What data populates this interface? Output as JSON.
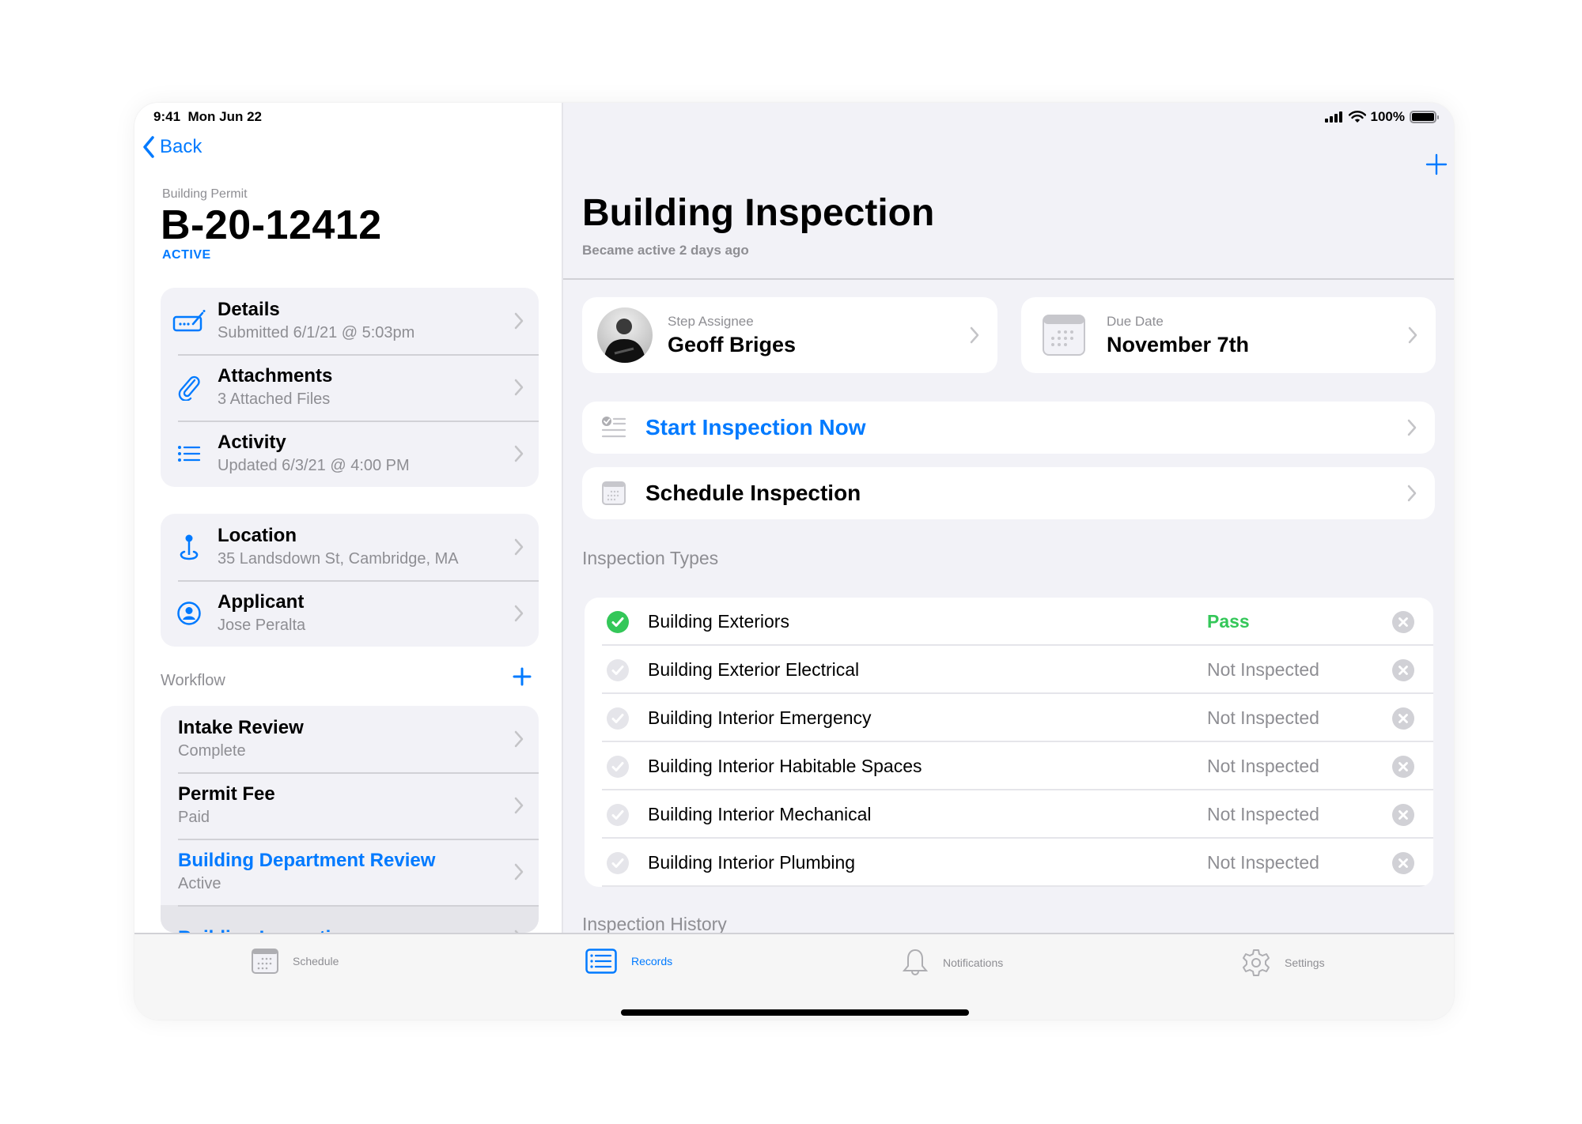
{
  "status_bar": {
    "time": "9:41",
    "date": "Mon Jun 22",
    "battery": "100%"
  },
  "nav": {
    "back_label": "Back"
  },
  "permit": {
    "type_label": "Building Permit",
    "number": "B-20-12412",
    "status": "ACTIVE"
  },
  "info_items": [
    {
      "icon": "details-form-icon",
      "title": "Details",
      "subtitle": "Submitted 6/1/21 @ 5:03pm"
    },
    {
      "icon": "paperclip-icon",
      "title": "Attachments",
      "subtitle": "3 Attached Files"
    },
    {
      "icon": "list-icon",
      "title": "Activity",
      "subtitle": "Updated 6/3/21 @ 4:00 PM"
    }
  ],
  "contact_items": [
    {
      "icon": "location-pin-icon",
      "title": "Location",
      "subtitle": "35 Landsdown St, Cambridge, MA"
    },
    {
      "icon": "person-circle-icon",
      "title": "Applicant",
      "subtitle": "Jose Peralta"
    }
  ],
  "workflow": {
    "label": "Workflow",
    "steps": [
      {
        "title": "Intake Review",
        "status": "Complete",
        "highlight": false
      },
      {
        "title": "Permit Fee",
        "status": "Paid",
        "highlight": false
      },
      {
        "title": "Building Department Review",
        "status": "Active",
        "highlight": true
      },
      {
        "title": "Building Inspection",
        "status": "",
        "highlight": true
      }
    ]
  },
  "detail": {
    "title": "Building Inspection",
    "subtitle": "Became active 2 days ago",
    "assignee": {
      "label": "Step Assignee",
      "name": "Geoff Briges"
    },
    "due": {
      "label": "Due Date",
      "value": "November 7th"
    },
    "start_action": "Start Inspection Now",
    "schedule_action": "Schedule Inspection",
    "types_label": "Inspection Types",
    "history_label": "Inspection History",
    "inspection_types": [
      {
        "name": "Building Exteriors",
        "status": "Pass",
        "passed": true
      },
      {
        "name": "Building Exterior Electrical",
        "status": "Not Inspected",
        "passed": false
      },
      {
        "name": "Building Interior Emergency",
        "status": "Not Inspected",
        "passed": false
      },
      {
        "name": "Building Interior Habitable Spaces",
        "status": "Not Inspected",
        "passed": false
      },
      {
        "name": "Building Interior Mechanical",
        "status": "Not Inspected",
        "passed": false
      },
      {
        "name": "Building Interior Plumbing",
        "status": "Not Inspected",
        "passed": false
      }
    ]
  },
  "tabs": [
    {
      "label": "Schedule",
      "icon": "calendar-icon",
      "active": false
    },
    {
      "label": "Records",
      "icon": "records-list-icon",
      "active": true
    },
    {
      "label": "Notifications",
      "icon": "bell-icon",
      "active": false
    },
    {
      "label": "Settings",
      "icon": "gear-icon",
      "active": false
    }
  ],
  "colors": {
    "accent": "#007aff",
    "pass": "#34c759",
    "secondary_text": "#8e8e93",
    "grouped_bg": "#f2f2f7"
  }
}
